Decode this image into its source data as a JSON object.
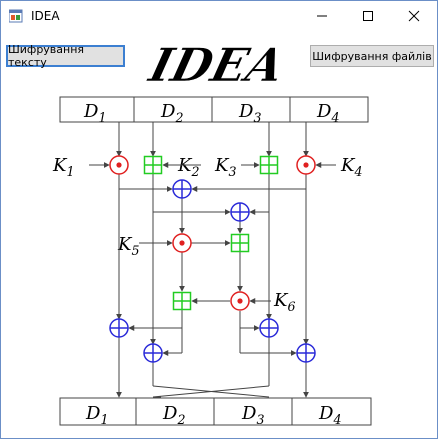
{
  "window": {
    "title": "IDEA",
    "controls": [
      "minimize",
      "maximize",
      "close"
    ]
  },
  "toolbar": {
    "text_button": "Шифрування тексту",
    "file_button": "Шифрування файлів"
  },
  "logo": {
    "text": "IDEA"
  },
  "diagram": {
    "input_blocks": [
      "D",
      "D",
      "D",
      "D"
    ],
    "input_subscripts": [
      "1",
      "2",
      "3",
      "4"
    ],
    "output_blocks": [
      "D",
      "D",
      "D",
      "D"
    ],
    "output_subscripts": [
      "1",
      "2",
      "3",
      "4"
    ],
    "keys": [
      {
        "label": "K",
        "sub": "1"
      },
      {
        "label": "K",
        "sub": "2"
      },
      {
        "label": "K",
        "sub": "3"
      },
      {
        "label": "K",
        "sub": "4"
      },
      {
        "label": "K",
        "sub": "5"
      },
      {
        "label": "K",
        "sub": "6"
      }
    ],
    "colors": {
      "multiply": "#e02020",
      "add": "#22cc22",
      "xor": "#2a2ad8",
      "line": "#444444"
    }
  }
}
